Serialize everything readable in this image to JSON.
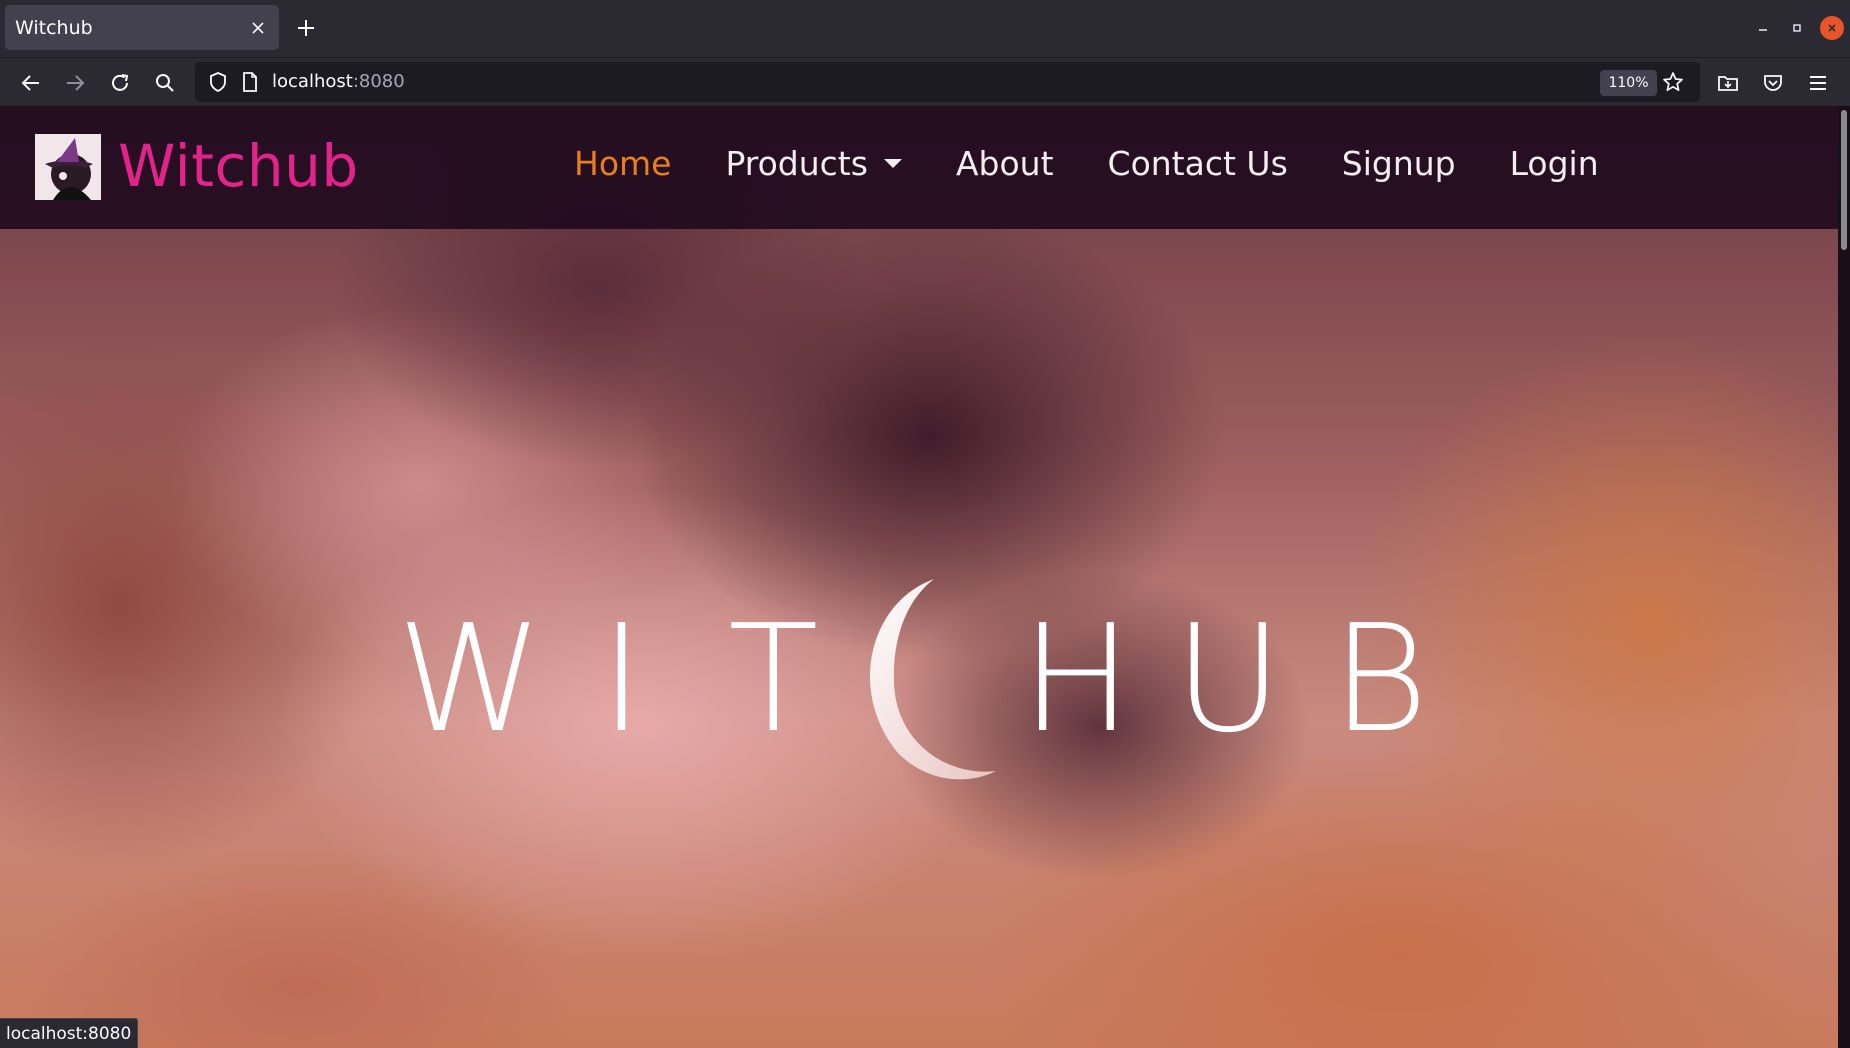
{
  "browser": {
    "tab_title": "Witchub",
    "url_host": "localhost",
    "url_port": ":8080",
    "zoom": "110%",
    "status_url": "localhost:8080"
  },
  "site": {
    "brand": "Witchub",
    "nav": [
      {
        "label": "Home",
        "active": true
      },
      {
        "label": "Products",
        "dropdown": true
      },
      {
        "label": "About"
      },
      {
        "label": "Contact Us"
      },
      {
        "label": "Signup"
      },
      {
        "label": "Login"
      }
    ],
    "hero_letters_left": [
      "W",
      "I",
      "T"
    ],
    "hero_letters_right": [
      "H",
      "U",
      "B"
    ]
  },
  "colors": {
    "brand": "#e2238c",
    "active_nav": "#e87f1f",
    "nav_bg": "#1c081c"
  },
  "icons": {
    "tab_close": "close-icon",
    "new_tab": "plus-icon",
    "back": "back-arrow-icon",
    "forward": "forward-arrow-icon",
    "reload": "reload-icon",
    "search": "search-icon",
    "shield": "shield-icon",
    "page": "page-icon",
    "bookmark": "star-icon",
    "downloads": "folder-download-icon",
    "pocket": "pocket-icon",
    "menu": "hamburger-menu-icon",
    "minimize": "minimize-icon",
    "maximize": "maximize-icon",
    "close_window": "close-window-icon",
    "moon": "crescent-moon-icon"
  }
}
